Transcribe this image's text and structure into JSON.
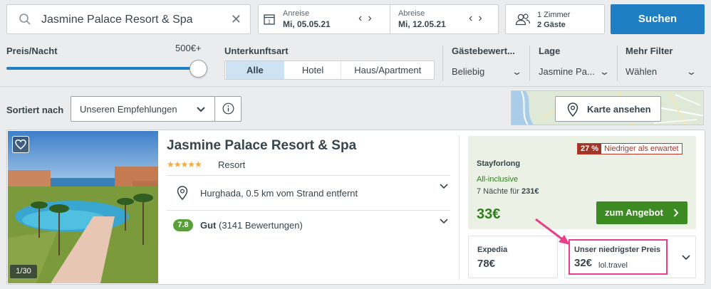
{
  "search": {
    "query": "Jasmine Palace Resort & Spa",
    "clear_icon": "close-icon",
    "checkin_label": "Anreise",
    "checkin_value": "Mi, 05.05.21",
    "checkout_label": "Abreise",
    "checkout_value": "Mi, 12.05.21",
    "rooms": "1 Zimmer",
    "guests": "2 Gäste",
    "search_button": "Suchen"
  },
  "filters": {
    "price_label": "Preis/Nacht",
    "price_max": "500€+",
    "price_slider_fraction": 1.0,
    "type_label": "Unterkunftsart",
    "type_options": [
      "Alle",
      "Hotel",
      "Haus/Apartment"
    ],
    "type_selected": "Alle",
    "rating_label": "Gästebewert...",
    "rating_value": "Beliebig",
    "location_label": "Lage",
    "location_value": "Jasmine Pa...",
    "more_label": "Mehr Filter",
    "more_value": "Wählen"
  },
  "sort": {
    "label": "Sortiert nach",
    "value": "Unseren Empfehlungen",
    "map_button": "Karte ansehen"
  },
  "hotel": {
    "name": "Jasmine Palace Resort & Spa",
    "stars": "★★★★★",
    "type": "Resort",
    "location": "Hurghada, 0.5 km vom Strand entfernt",
    "rating_score": "7.8",
    "rating_word": "Gut",
    "rating_count": "(3141 Bewertungen)",
    "photo_counter": "1/30",
    "offer": {
      "discount_pct": "27 %",
      "discount_text": "Niedriger als erwartet",
      "provider": "Stayforlong",
      "board": "All-inclusive",
      "nights_text": "7 Nächte für ",
      "nights_total": "231€",
      "price": "33€",
      "button": "zum Angebot"
    },
    "alternatives": [
      {
        "provider": "Expedia",
        "price": "78€"
      },
      {
        "label": "Unser niedrigster Preis",
        "price": "32€",
        "provider": "lol.travel"
      }
    ]
  },
  "colors": {
    "accent_blue": "#1f7fc5",
    "deal_green": "#3c8a22",
    "discount_red": "#a0362a",
    "highlight_pink": "#e83e8c"
  }
}
